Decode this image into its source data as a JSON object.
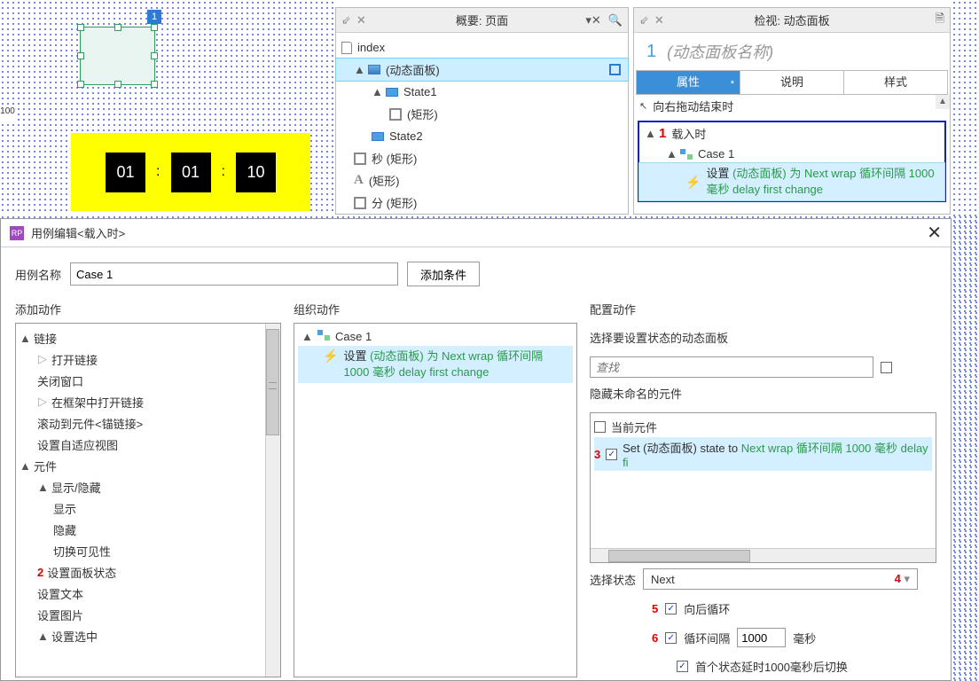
{
  "ruler": {
    "mark": "100"
  },
  "canvas": {
    "badge": "1",
    "digits": [
      "01",
      "01",
      "10"
    ],
    "colon": ":"
  },
  "outline": {
    "title": "概要: 页面",
    "index": "index",
    "dp": "(动态面板)",
    "state1": "State1",
    "rect": "(矩形)",
    "state2": "State2",
    "sec_rect": "秒 (矩形)",
    "a_rect": "(矩形)",
    "div_rect": "分 (矩形)"
  },
  "inspect": {
    "title": "检视: 动态面板",
    "num": "1",
    "name": "(动态面板名称)",
    "tabs": {
      "prop": "属性",
      "desc": "说明",
      "style": "样式",
      "star": "*"
    },
    "prev_event": "向右拖动结束时",
    "marker1": "1",
    "load_event": "载入时",
    "case1": "Case 1",
    "action_pre": "设置 ",
    "action_g1": "(动态面板) 为 Next wrap 循环间隔 1000 毫秒 delay first change"
  },
  "dialog": {
    "title": "用例编辑<载入时>",
    "name_lbl": "用例名称",
    "name_val": "Case 1",
    "add_cond": "添加条件",
    "add_action": "添加动作",
    "org_action": "组织动作",
    "cfg_action": "配置动作",
    "actions": {
      "link": "链接",
      "open": "打开链接",
      "close": "关闭窗口",
      "frame": "在框架中打开链接",
      "scroll": "滚动到元件<锚链接>",
      "adapt": "设置自适应视图",
      "widget": "元件",
      "showhide": "显示/隐藏",
      "show": "显示",
      "hide": "隐藏",
      "toggle": "切换可见性",
      "setpanel": "设置面板状态",
      "settext": "设置文本",
      "setimg": "设置图片",
      "setsel": "设置选中",
      "marker2": "2"
    },
    "org": {
      "case1": "Case 1",
      "set": "设置 ",
      "green": "(动态面板) 为 Next wrap 循环间隔 1000 毫秒 delay first change"
    },
    "cfg": {
      "sel_dp": "选择要设置状态的动态面板",
      "search": "查找",
      "hide_unnamed": "隐藏未命名的元件",
      "current": "当前元件",
      "marker3": "3",
      "set_text": "Set (动态面板) state to ",
      "set_green": "Next wrap 循环间隔 1000 毫秒 delay fi",
      "sel_state": "选择状态",
      "next": "Next",
      "marker4": "4",
      "marker5": "5",
      "wrap": "向后循环",
      "marker6": "6",
      "interval": "循环间隔",
      "interval_val": "1000",
      "ms": "毫秒",
      "delay": "首个状态延时1000毫秒后切换"
    }
  }
}
